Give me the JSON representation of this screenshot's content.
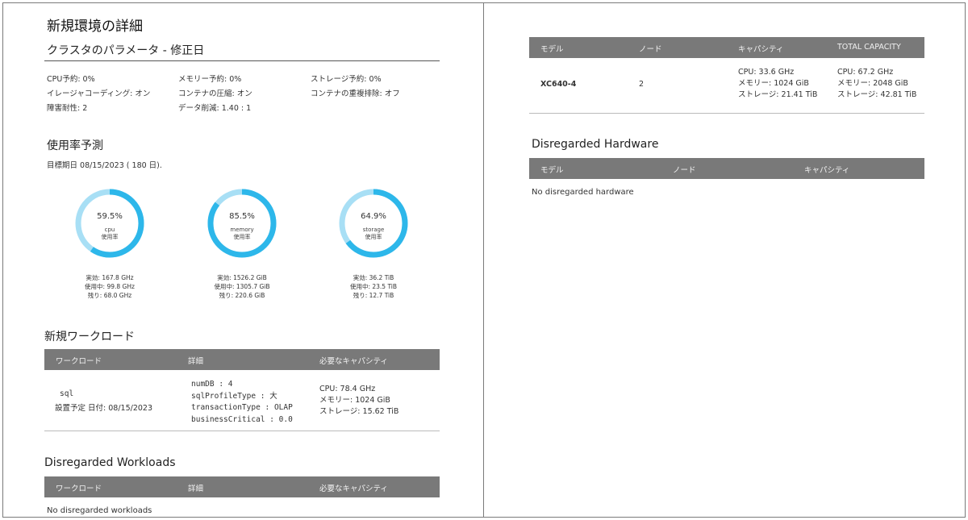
{
  "left": {
    "title": "新規環境の詳細",
    "cluster_params": {
      "heading": "クラスタのパラメータ - 修正日",
      "rows": [
        [
          "CPU予約: 0%",
          "メモリー予約: 0%",
          "ストレージ予約: 0%"
        ],
        [
          "イレージャコーディング: オン",
          "コンテナの圧縮: オン",
          "コンテナの重複排除: オフ"
        ],
        [
          "障害耐性: 2",
          "データ削減: 1.40 : 1",
          ""
        ]
      ]
    },
    "forecast": {
      "heading": "使用率予測",
      "target": "目標期日 08/15/2023 ( 180 日).",
      "gauges": [
        {
          "pct_text": "59.5%",
          "value": 59.5,
          "name": "cpu",
          "sub": "使用率",
          "effective": "実効: 167.8 GHz",
          "used": "使用中: 99.8 GHz",
          "remaining": "残り: 68.0 GHz"
        },
        {
          "pct_text": "85.5%",
          "value": 85.5,
          "name": "memory",
          "sub": "使用率",
          "effective": "実効: 1526.2 GiB",
          "used": "使用中: 1305.7 GiB",
          "remaining": "残り: 220.6 GiB"
        },
        {
          "pct_text": "64.9%",
          "value": 64.9,
          "name": "storage",
          "sub": "使用率",
          "effective": "実効: 36.2 TiB",
          "used": "使用中: 23.5 TiB",
          "remaining": "残り: 12.7 TiB"
        }
      ],
      "colors": {
        "used": "#2db7ea",
        "remaining": "#a8dff5"
      }
    },
    "new_workloads": {
      "heading": "新規ワークロード",
      "columns": [
        "ワークロード",
        "詳細",
        "必要なキャパシティ"
      ],
      "row": {
        "name": "sql",
        "scheduled": "設置予定 日付: 08/15/2023",
        "details": [
          "numDB : 4",
          "sqlProfileType : 大",
          "transactionType : OLAP",
          "businessCritical : 0.0"
        ],
        "capacity": [
          "CPU: 78.4 GHz",
          "メモリー: 1024 GiB",
          "ストレージ: 15.62 TiB"
        ]
      }
    },
    "disregarded_workloads": {
      "heading": "Disregarded Workloads",
      "columns": [
        "ワークロード",
        "詳細",
        "必要なキャパシティ"
      ],
      "empty": "No disregarded workloads"
    }
  },
  "right": {
    "hardware": {
      "columns": [
        "モデル",
        "ノード",
        "キャパシティ",
        "TOTAL CAPACITY"
      ],
      "row": {
        "model": "XC640-4",
        "nodes": "2",
        "capacity": [
          "CPU: 33.6 GHz",
          "メモリー: 1024 GiB",
          "ストレージ: 21.41 TiB"
        ],
        "total": [
          "CPU: 67.2 GHz",
          "メモリー: 2048 GiB",
          "ストレージ: 42.81 TiB"
        ]
      }
    },
    "disregarded_hardware": {
      "heading": "Disregarded Hardware",
      "columns": [
        "モデル",
        "ノード",
        "キャパシティ"
      ],
      "empty": "No disregarded hardware"
    }
  }
}
